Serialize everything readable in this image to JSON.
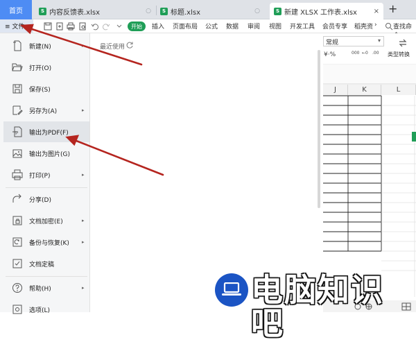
{
  "tabs": {
    "home": "首页",
    "files": [
      {
        "name": "内容反馈表.xlsx"
      },
      {
        "name": "标题.xlsx"
      },
      {
        "name": "新建 XLSX 工作表.xlsx"
      }
    ],
    "close_glyph": "×",
    "new_tab_glyph": "+",
    "dirty_dot": "○"
  },
  "ribbon": {
    "menu_label": "≡ 文件",
    "start": "开始",
    "items": [
      "插入",
      "页面布局",
      "公式",
      "数据",
      "审阅",
      "视图",
      "开发工具",
      "会员专享",
      "稻壳资"
    ],
    "more": "›",
    "search": "查找命令"
  },
  "sheet": {
    "format": "常规",
    "format_arrow": "▾",
    "convert_label": "类型转换",
    "columns": [
      "J",
      "K",
      "L"
    ]
  },
  "file_menu": {
    "items": [
      {
        "label": "新建(N)",
        "icon": "new-doc-icon",
        "has_sub": true
      },
      {
        "label": "打开(O)",
        "icon": "folder-open-icon",
        "has_sub": false
      },
      {
        "label": "保存(S)",
        "icon": "save-icon",
        "has_sub": false
      },
      {
        "label": "另存为(A)",
        "icon": "save-as-icon",
        "has_sub": true
      },
      {
        "label": "输出为PDF(F)",
        "icon": "pdf-export-icon",
        "has_sub": false
      },
      {
        "label": "输出为图片(G)",
        "icon": "image-export-icon",
        "has_sub": false
      },
      {
        "label": "打印(P)",
        "icon": "print-icon",
        "has_sub": true
      },
      {
        "label": "分享(D)",
        "icon": "share-icon",
        "has_sub": false
      },
      {
        "label": "文档加密(E)",
        "icon": "lock-icon",
        "has_sub": true
      },
      {
        "label": "备份与恢复(K)",
        "icon": "backup-icon",
        "has_sub": true
      },
      {
        "label": "文档定稿",
        "icon": "finalize-icon",
        "has_sub": false
      },
      {
        "label": "帮助(H)",
        "icon": "help-icon",
        "has_sub": true
      },
      {
        "label": "选项(L)",
        "icon": "settings-icon",
        "has_sub": false
      }
    ],
    "arrow_glyph": "▸"
  },
  "recent": {
    "title": "最近使用"
  },
  "watermark": {
    "text": "电脑知识吧",
    "icon": "laptop-icon"
  },
  "colors": {
    "accent_blue": "#4e8cf4",
    "excel_green": "#1f9e57",
    "annotation_arrow": "#b5251f"
  }
}
